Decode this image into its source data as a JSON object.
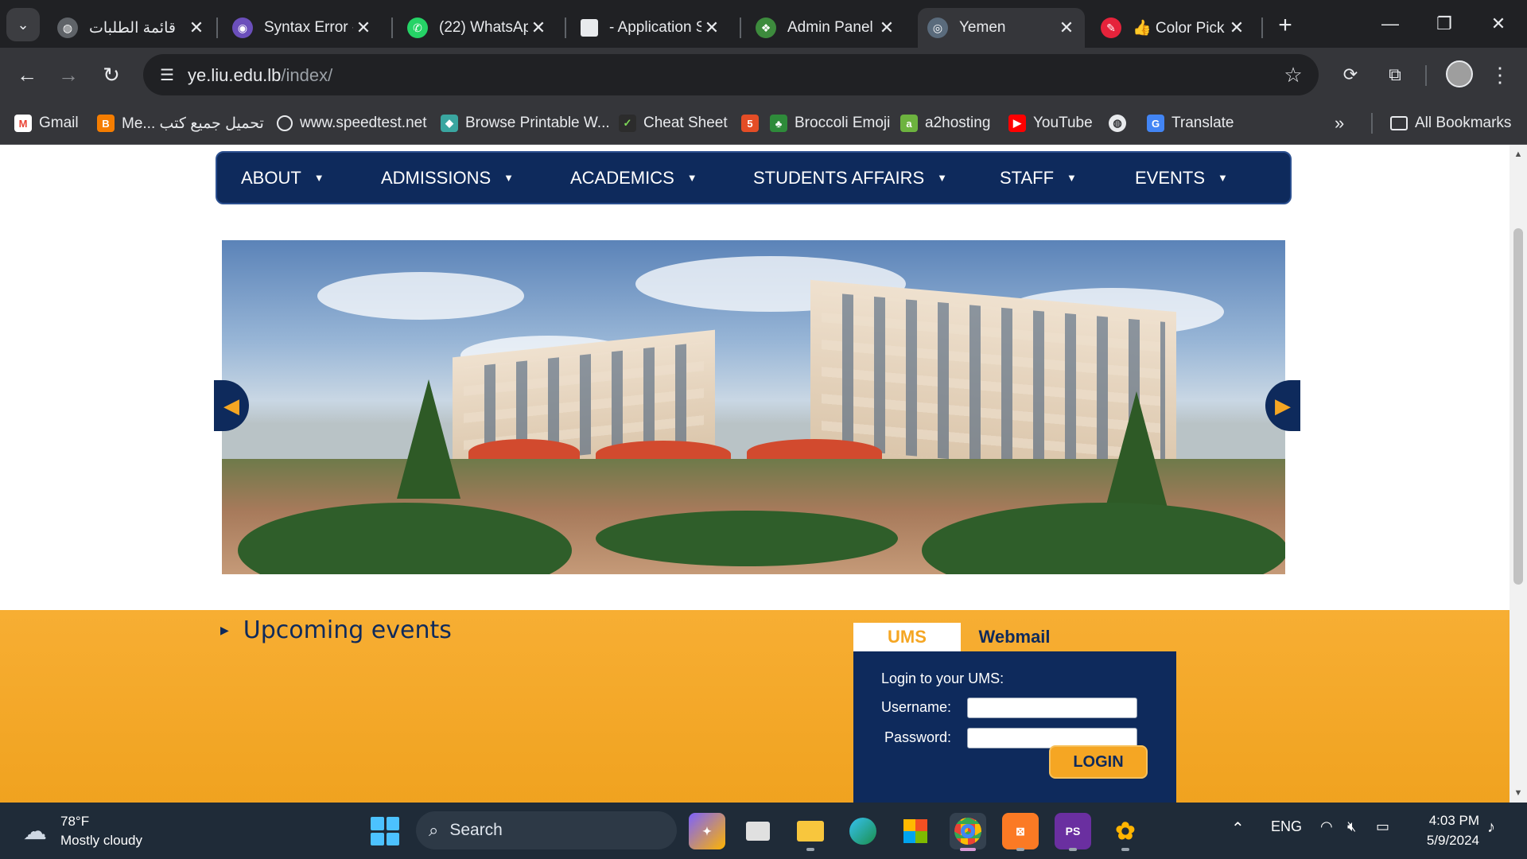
{
  "browser": {
    "tabs": [
      {
        "title": "قائمة الطلبات",
        "icon": "globe-icon"
      },
      {
        "title": "Syntax Error -",
        "icon": "syntax-error-icon"
      },
      {
        "title": "(22) WhatsApp",
        "icon": "whatsapp-icon"
      },
      {
        "title": "- Application S",
        "icon": "document-icon"
      },
      {
        "title": "Admin Panel -",
        "icon": "admin-panel-icon"
      },
      {
        "title": "Yemen",
        "icon": "liu-icon",
        "active": true
      },
      {
        "title": "👍 Color Pick",
        "icon": "color-picker-icon"
      }
    ],
    "url_host": "ye.liu.edu.lb",
    "url_path": "/index/",
    "bookmarks": [
      {
        "label": "Gmail",
        "icon": "gmail-icon"
      },
      {
        "label": "Me... تحميل جميع كتب",
        "icon": "blogger-icon"
      },
      {
        "label": "www.speedtest.net",
        "icon": "speedtest-icon"
      },
      {
        "label": "Browse Printable W...",
        "icon": "printable-icon"
      },
      {
        "label": "Cheat Sheet",
        "icon": "cheat-sheet-icon"
      },
      {
        "label": "",
        "icon": "html5-icon"
      },
      {
        "label": "Broccoli Emoji",
        "icon": "broccoli-icon"
      },
      {
        "label": "a2hosting",
        "icon": "a2hosting-icon"
      },
      {
        "label": "YouTube",
        "icon": "youtube-icon"
      },
      {
        "label": "",
        "icon": "globe-icon"
      },
      {
        "label": "Translate",
        "icon": "translate-icon"
      }
    ],
    "all_bookmarks": "All Bookmarks"
  },
  "page": {
    "nav": [
      {
        "label": "ABOUT"
      },
      {
        "label": "ADMISSIONS"
      },
      {
        "label": "ACADEMICS"
      },
      {
        "label": "STUDENTS AFFAIRS"
      },
      {
        "label": "STAFF"
      },
      {
        "label": "EVENTS"
      }
    ],
    "upcoming_events": "Upcoming events",
    "login": {
      "tab_ums": "UMS",
      "tab_webmail": "Webmail",
      "title": "Login to your UMS:",
      "username_label": "Username:",
      "password_label": "Password:",
      "button": "LOGIN"
    },
    "colors": {
      "navy": "#0e2a5c",
      "orange": "#f5a623"
    }
  },
  "taskbar": {
    "weather_temp": "78°F",
    "weather_desc": "Mostly cloudy",
    "search_label": "Search",
    "language": "ENG",
    "time": "4:03 PM",
    "date": "5/9/2024"
  }
}
